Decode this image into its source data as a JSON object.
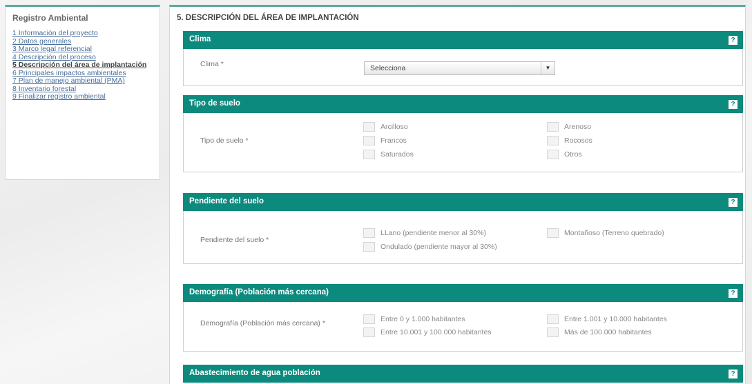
{
  "sidebar": {
    "title": "Registro Ambiental",
    "items": [
      {
        "label": "1 Información del proyecto"
      },
      {
        "label": "2 Datos generales"
      },
      {
        "label": "3 Marco legal referencial"
      },
      {
        "label": "4 Descripción del proceso"
      },
      {
        "label": "5 Descripción del área de implantación",
        "active": true
      },
      {
        "label": "6 Principales impactos ambientales"
      },
      {
        "label": "7 Plan de manejo ambiental (PMA)"
      },
      {
        "label": "8 Inventario forestal"
      },
      {
        "label": "9 Finalizar registro ambiental"
      }
    ]
  },
  "main": {
    "page_title": "5. DESCRIPCIÓN DEL ÁREA DE IMPLANTACIÓN",
    "help_label": "?",
    "clima": {
      "header": "Clima",
      "label": "Clima *",
      "select_value": "Selecciona",
      "arrow": "▼"
    },
    "tipo_suelo": {
      "header": "Tipo de suelo",
      "label": "Tipo de suelo *",
      "options": [
        "Arcilloso",
        "Arenoso",
        "Francos",
        "Rocosos",
        "Saturados",
        "Otros"
      ]
    },
    "pendiente": {
      "header": "Pendiente del suelo",
      "label": "Pendiente del suelo *",
      "options": [
        "LLano (pendiente menor al 30%)",
        "Montañoso (Terreno quebrado)",
        "Ondulado (pendiente mayor al 30%)"
      ]
    },
    "demografia": {
      "header": "Demografía (Población más cercana)",
      "label": "Demografía (Población más cercana) *",
      "options": [
        "Entre 0 y 1.000 habitantes",
        "Entre 1.001 y 10.000 habitantes",
        "Entre 10.001 y 100.000 habitantes",
        "Más de 100.000 habitantes"
      ]
    },
    "agua": {
      "header": "Abastecimiento de agua población"
    }
  }
}
